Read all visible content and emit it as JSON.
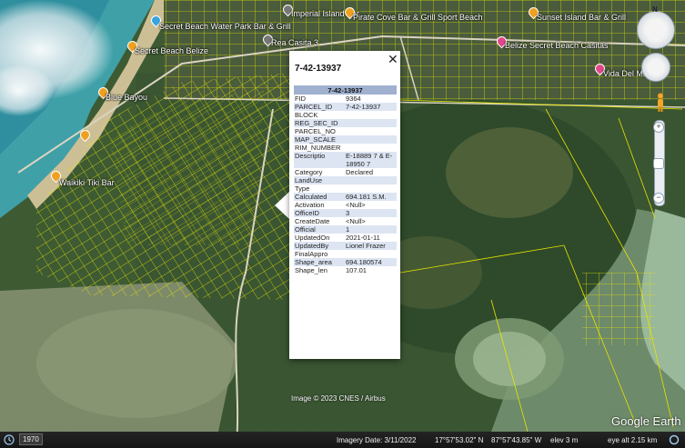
{
  "places": [
    {
      "name": "Secret Beach Water Park Bar & Grill",
      "color": "blue"
    },
    {
      "name": "Secret Beach Belize",
      "color": "orange"
    },
    {
      "name": "Blue Bayou",
      "color": "orange"
    },
    {
      "name": "Waikiki Tiki Bar",
      "color": "orange"
    },
    {
      "name": "Rea Casita 3",
      "color": "gray"
    },
    {
      "name": "Imperial Island Bar",
      "color": "gray"
    },
    {
      "name": "Pirate Cove Bar & Grill Sport Beach",
      "color": "orange"
    },
    {
      "name": "Sunset Island Bar & Grill",
      "color": "orange"
    },
    {
      "name": "Belize Secret Beach Casitas",
      "color": "pink"
    },
    {
      "name": "Vida Del Mar",
      "color": "pink"
    }
  ],
  "balloon": {
    "title": "7-42-13937",
    "close_label": "✕",
    "table_header": "7-42-13937",
    "rows": [
      {
        "key": "FID",
        "value": "9364"
      },
      {
        "key": "PARCEL_ID",
        "value": "7-42-13937"
      },
      {
        "key": "BLOCK",
        "value": ""
      },
      {
        "key": "REG_SEC_ID",
        "value": ""
      },
      {
        "key": "PARCEL_NO",
        "value": ""
      },
      {
        "key": "MAP_SCALE",
        "value": ""
      },
      {
        "key": "RIM_NUMBER",
        "value": ""
      },
      {
        "key": "Descriptio",
        "value": "E-18889 7 & E-18950 7"
      },
      {
        "key": "Category",
        "value": "Declared"
      },
      {
        "key": "LandUse",
        "value": ""
      },
      {
        "key": "Type",
        "value": ""
      },
      {
        "key": "Calculated",
        "value": "694.181 S.M."
      },
      {
        "key": "Activation",
        "value": "<Null>"
      },
      {
        "key": "OfficeID",
        "value": "3"
      },
      {
        "key": "CreateDate",
        "value": "<Null>"
      },
      {
        "key": "Official",
        "value": "1"
      },
      {
        "key": "UpdatedOn",
        "value": "2021-01-11"
      },
      {
        "key": "UpdatedBy",
        "value": "Lionel Frazer"
      },
      {
        "key": "FinalAppro",
        "value": ""
      },
      {
        "key": "Shape_area",
        "value": "694.180574"
      },
      {
        "key": "Shape_len",
        "value": "107.01"
      }
    ]
  },
  "credit": "Image © 2023 CNES / Airbus",
  "watermark": "Google Earth",
  "nav": {
    "north_label": "N",
    "zoom_in": "+",
    "zoom_out": "−"
  },
  "status": {
    "year": "1970",
    "imagery_date": "Imagery Date: 3/11/2022",
    "latitude": "17°57'53.02\" N",
    "longitude": "87°57'43.85\" W",
    "elevation": "elev    3 m",
    "eye_alt": "eye alt   2.15 km"
  },
  "colors": {
    "parcel_lines": "#e6e600",
    "sea": "#3fa0a8",
    "land": "#3b5a34"
  }
}
